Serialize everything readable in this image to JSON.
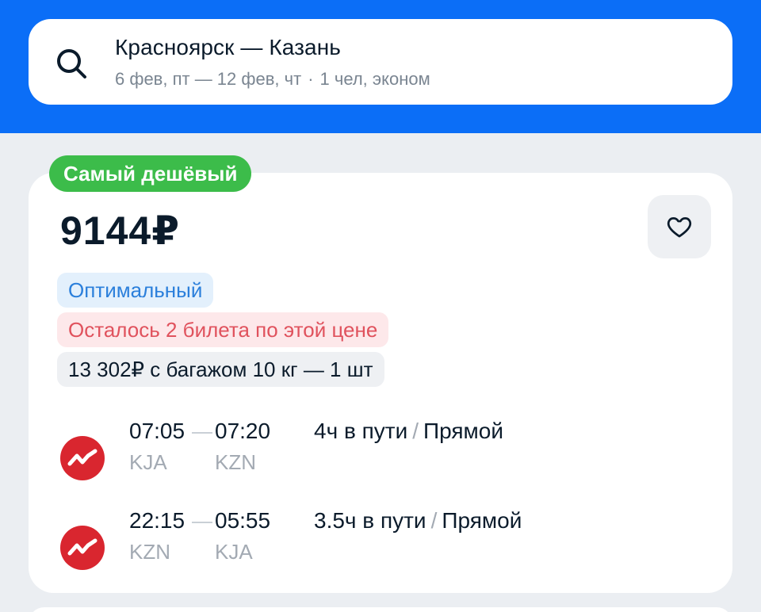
{
  "search": {
    "route": "Красноярск — Казань",
    "dates": "6 фев, пт — 12 фев, чт",
    "passengers": "1 чел, эконом"
  },
  "offer": {
    "badge": "Самый дешёвый",
    "price": "9144₽",
    "chips": {
      "optimal": "Оптимальный",
      "remaining": "Осталось 2 билета по этой цене",
      "baggage": "13 302₽ с багажом 10 кг — 1 шт"
    },
    "flights": [
      {
        "depart_time": "07:05",
        "arrive_time": "07:20",
        "from_code": "KJA",
        "to_code": "KZN",
        "duration": "4ч в пути",
        "type": "Прямой"
      },
      {
        "depart_time": "22:15",
        "arrive_time": "05:55",
        "from_code": "KZN",
        "to_code": "KJA",
        "duration": "3.5ч в пути",
        "type": "Прямой"
      }
    ]
  },
  "icons": {
    "search": "search-icon",
    "favorite": "heart-icon",
    "airline": "airline-logo-icon"
  },
  "colors": {
    "header_blue": "#0b6ef7",
    "badge_green": "#3cbc4a",
    "optimal_blue": "#2b7fdb",
    "warning_red": "#e0525d",
    "airline_red": "#d9262f"
  }
}
